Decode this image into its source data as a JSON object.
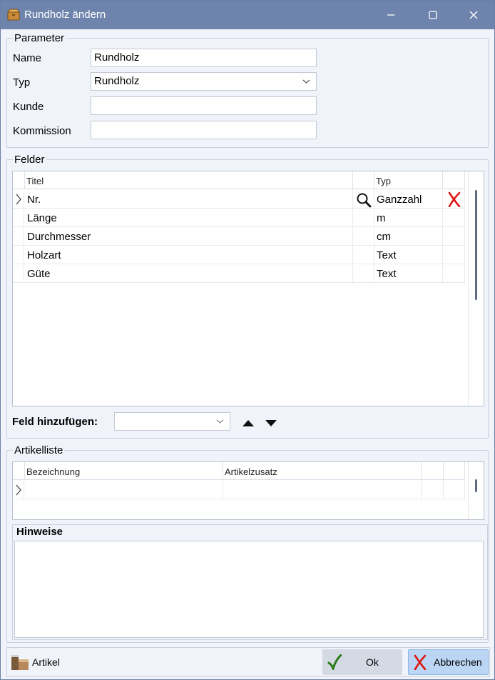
{
  "window": {
    "title": "Rundholz ändern",
    "colors": {
      "titlebar": "#6f84ad",
      "accent_btn": "#bad6f4",
      "neutral_btn": "#d4dae3",
      "delete_red": "#e01515",
      "ok_green": "#2d7a19"
    }
  },
  "parameter": {
    "legend": "Parameter",
    "name": {
      "label": "Name",
      "value": "Rundholz"
    },
    "typ": {
      "label": "Typ",
      "value": "Rundholz"
    },
    "kunde": {
      "label": "Kunde",
      "value": ""
    },
    "kommission": {
      "label": "Kommission",
      "value": ""
    }
  },
  "felder": {
    "legend": "Felder",
    "columns": {
      "titel": "Titel",
      "typ": "Typ"
    },
    "rows": [
      {
        "titel": "Nr.",
        "typ": "Ganzzahl",
        "current": true,
        "search": true,
        "delete": true
      },
      {
        "titel": "Länge",
        "typ": "m"
      },
      {
        "titel": "Durchmesser",
        "typ": "cm"
      },
      {
        "titel": "Holzart",
        "typ": "Text"
      },
      {
        "titel": "Güte",
        "typ": "Text"
      }
    ],
    "add_label": "Feld hinzufügen:",
    "add_value": ""
  },
  "artikelliste": {
    "legend": "Artikelliste",
    "columns": {
      "bezeichnung": "Bezeichnung",
      "artikelzusatz": "Artikelzusatz"
    }
  },
  "hinweise": {
    "label": "Hinweise",
    "value": ""
  },
  "footer": {
    "artikel_label": "Artikel",
    "ok_label": "Ok",
    "cancel_label": "Abbrechen"
  }
}
